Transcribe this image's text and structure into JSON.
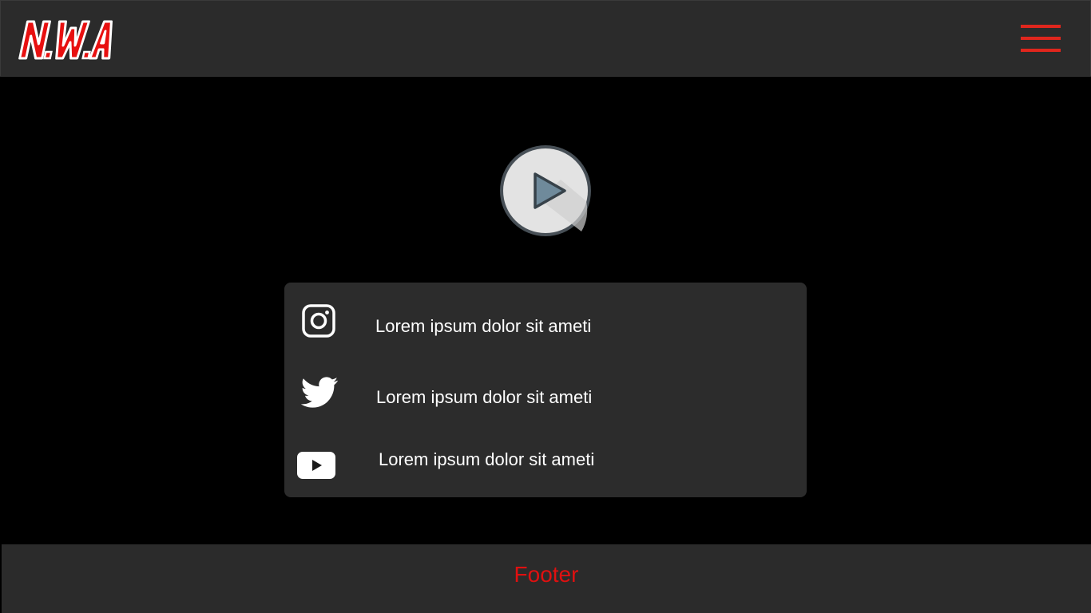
{
  "header": {
    "logo_text": "N.W.A",
    "menu_icon": "hamburger-menu-icon"
  },
  "main": {
    "play_icon": "play-icon"
  },
  "social": {
    "items": [
      {
        "icon": "instagram-icon",
        "label": "Lorem ipsum dolor sit ameti"
      },
      {
        "icon": "twitter-icon",
        "label": "Lorem ipsum dolor sit ameti"
      },
      {
        "icon": "youtube-icon",
        "label": "Lorem ipsum dolor sit ameti"
      }
    ]
  },
  "footer": {
    "label": "Footer"
  },
  "colors": {
    "accent": "#e0261d",
    "header_bg": "#2b2b2b",
    "panel_bg": "#2c2c2c",
    "page_bg": "#000000",
    "footer_text": "#e01010"
  }
}
